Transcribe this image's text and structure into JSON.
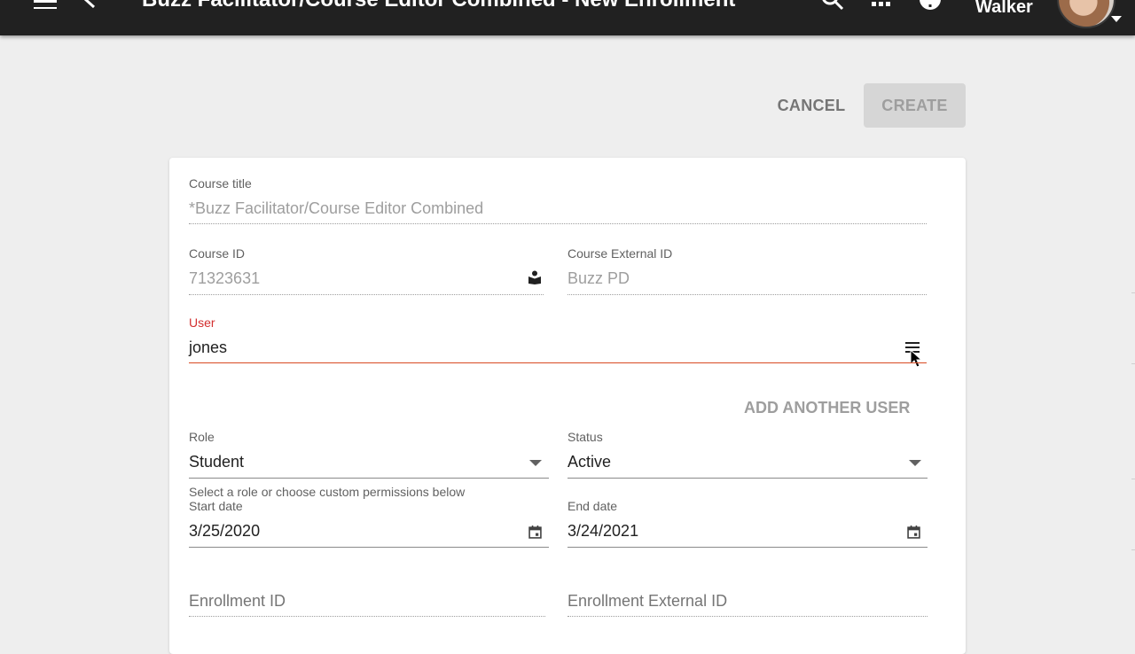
{
  "header": {
    "title": "Buzz Facilitator/Course Editor Combined - New Enrollment",
    "user_name": "Walker"
  },
  "actions": {
    "cancel_label": "CANCEL",
    "create_label": "CREATE"
  },
  "form": {
    "course_title": {
      "label": "Course title",
      "value": "*Buzz Facilitator/Course Editor Combined"
    },
    "course_id": {
      "label": "Course ID",
      "value": "71323631"
    },
    "course_external_id": {
      "label": "Course External ID",
      "value": "Buzz PD"
    },
    "user": {
      "label": "User",
      "value": "jones"
    },
    "add_another_user_label": "ADD ANOTHER USER",
    "role": {
      "label": "Role",
      "value": "Student",
      "helper": "Select a role or choose custom permissions below"
    },
    "status": {
      "label": "Status",
      "value": "Active"
    },
    "start_date": {
      "label": "Start date",
      "value": "3/25/2020"
    },
    "end_date": {
      "label": "End date",
      "value": "3/24/2021"
    },
    "enrollment_id": {
      "placeholder": "Enrollment ID"
    },
    "enrollment_external_id": {
      "placeholder": "Enrollment External ID"
    }
  },
  "colors": {
    "topbar": "#212121",
    "accent_error": "#d32f2f",
    "background": "#eeeeee"
  },
  "icons": [
    "menu-icon",
    "back-arrow-icon",
    "search-icon",
    "apps-grid-icon",
    "help-icon",
    "book-reader-icon",
    "list-icon",
    "calendar-icon",
    "dropdown-arrow-icon",
    "mouse-cursor-icon"
  ]
}
